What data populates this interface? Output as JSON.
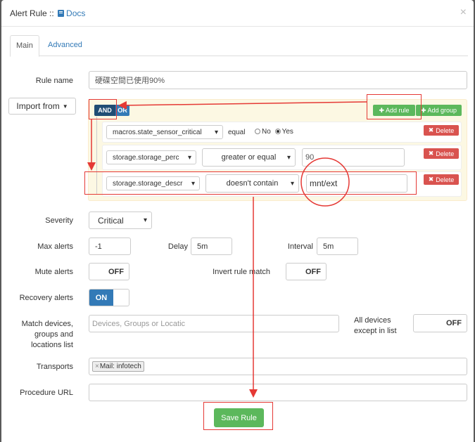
{
  "header": {
    "title_prefix": "Alert Rule :: ",
    "docs_label": "Docs",
    "close": "×"
  },
  "tabs": [
    {
      "label": "Main"
    },
    {
      "label": "Advanced"
    }
  ],
  "form": {
    "rule_name_label": "Rule name",
    "rule_name_value": "硬碟空間已使用90%",
    "import_label": "Import from",
    "builder": {
      "and_label": "AND",
      "or_label": "OR",
      "add_rule_label": "Add rule",
      "add_group_label": "Add group",
      "rules": [
        {
          "field": "macros.state_sensor_critical",
          "operator": "equal",
          "radio_no": "No",
          "radio_yes": "Yes",
          "delete": "Delete"
        },
        {
          "field": "storage.storage_perc",
          "operator": "greater or equal",
          "value": "90",
          "delete": "Delete"
        },
        {
          "field": "storage.storage_descr",
          "operator": "doesn't contain",
          "value": "mnt/ext",
          "delete": "Delete"
        }
      ]
    },
    "severity_label": "Severity",
    "severity_value": "Critical",
    "max_alerts_label": "Max alerts",
    "max_alerts_value": "-1",
    "delay_label": "Delay",
    "delay_value": "5m",
    "interval_label": "Interval",
    "interval_value": "5m",
    "mute_label": "Mute alerts",
    "mute_value": "OFF",
    "invert_label": "Invert rule match",
    "invert_value": "OFF",
    "recovery_label": "Recovery alerts",
    "recovery_value": "ON",
    "match_label_1": "Match devices,",
    "match_label_2": "groups and",
    "match_label_3": "locations list",
    "match_placeholder": "Devices, Groups or Locatic",
    "all_devices_label_1": "All devices",
    "all_devices_label_2": "except in list",
    "all_devices_value": "OFF",
    "transports_label": "Transports",
    "transport_tag": "Mail: infotech",
    "transport_tag_remove": "×",
    "procedure_label": "Procedure URL",
    "procedure_value": "",
    "save_label": "Save Rule"
  },
  "colors": {
    "primary": "#337ab7",
    "success": "#5cb85c",
    "danger": "#d9534f",
    "annotation": "#e53935"
  }
}
